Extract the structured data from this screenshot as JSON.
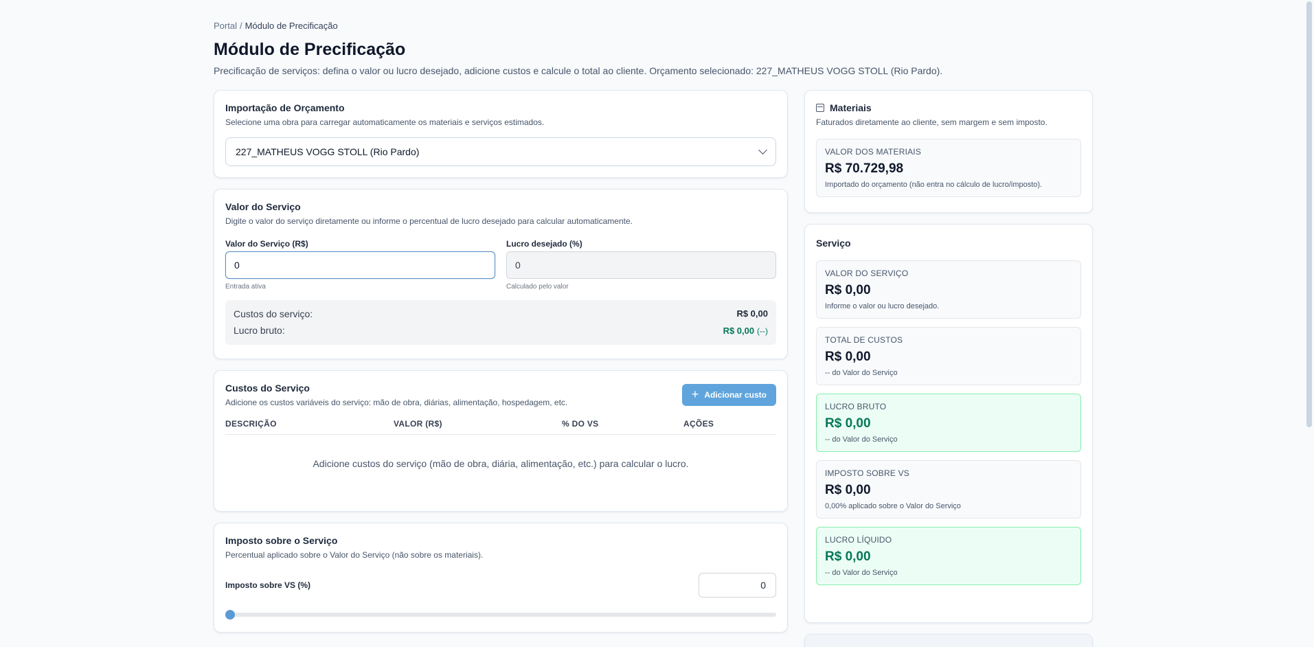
{
  "breadcrumb": {
    "root": "Portal",
    "separator": "/",
    "current": "Módulo de Precificação"
  },
  "page": {
    "title": "Módulo de Precificação",
    "description": "Precificação de serviços: defina o valor ou lucro desejado, adicione custos e calcule o total ao cliente. Orçamento selecionado: 227_MATHEUS VOGG STOLL (Rio Pardo)."
  },
  "import_card": {
    "title": "Importação de Orçamento",
    "subtitle": "Selecione uma obra para carregar automaticamente os materiais e serviços estimados.",
    "selected": "227_MATHEUS VOGG STOLL (Rio Pardo)"
  },
  "service_value_card": {
    "title": "Valor do Serviço",
    "subtitle": "Digite o valor do serviço diretamente ou informe o percentual de lucro desejado para calcular automaticamente.",
    "value_label": "Valor do Serviço (R$)",
    "value": "0",
    "value_hint": "Entrada ativa",
    "profit_label": "Lucro desejado (%)",
    "profit_value": "0",
    "profit_hint": "Calculado pelo valor",
    "costs_label": "Custos do serviço:",
    "costs_value": "R$ 0,00",
    "gross_label": "Lucro bruto:",
    "gross_value": "R$ 0,00",
    "gross_pct": "(--)"
  },
  "costs_card": {
    "title": "Custos do Serviço",
    "subtitle": "Adicione os custos variáveis do serviço: mão de obra, diárias, alimentação, hospedagem, etc.",
    "add_button": "Adicionar custo",
    "columns": [
      "DESCRIÇÃO",
      "VALOR (R$)",
      "% DO VS",
      "AÇÕES"
    ],
    "empty_message": "Adicione custos do serviço (mão de obra, diária, alimentação, etc.) para calcular o lucro."
  },
  "tax_card": {
    "title": "Imposto sobre o Serviço",
    "subtitle": "Percentual aplicado sobre o Valor do Serviço (não sobre os materiais).",
    "label": "Imposto sobre VS (%)",
    "value": "0",
    "slider_fraction": 0
  },
  "materials_card": {
    "title": "Materiais",
    "icon": "box-icon",
    "subtitle": "Faturados diretamente ao cliente, sem margem e sem imposto.",
    "metric_label": "VALOR DOS MATERIAIS",
    "metric_value": "R$ 70.729,98",
    "metric_note": "Importado do orçamento (não entra no cálculo de lucro/imposto)."
  },
  "service_card": {
    "title": "Serviço",
    "metrics": [
      {
        "label": "VALOR DO SERVIÇO",
        "value": "R$ 0,00",
        "note": "Informe o valor ou lucro desejado."
      },
      {
        "label": "TOTAL DE CUSTOS",
        "value": "R$ 0,00",
        "note": "-- do Valor do Serviço"
      },
      {
        "label": "LUCRO BRUTO",
        "value": "R$ 0,00",
        "note": "-- do Valor do Serviço"
      },
      {
        "label": "IMPOSTO SOBRE VS",
        "value": "R$ 0,00",
        "note": "0,00% aplicado sobre o Valor do Serviço"
      },
      {
        "label": "LUCRO LÍQUIDO",
        "value": "R$ 0,00",
        "note": "-- do Valor do Serviço"
      }
    ]
  },
  "colors": {
    "accent": "#5fa4dc",
    "positive": "#047857",
    "positive_bg": "#ecfdf5"
  }
}
